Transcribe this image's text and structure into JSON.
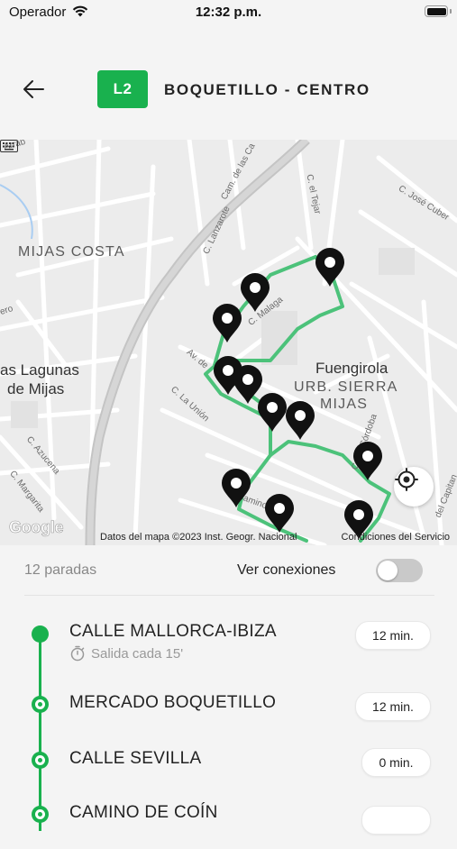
{
  "status_bar": {
    "carrier": "Operador",
    "time": "12:32 p.m."
  },
  "header": {
    "line_code": "L2",
    "route_name": "BOQUETILLO - CENTRO",
    "accent_color": "#19b14e"
  },
  "map": {
    "place_labels": [
      "MIJAS COSTA",
      "Fuengirola",
      "URB. SIERRA",
      "MIJAS",
      "as Lagunas",
      "de Mijas"
    ],
    "street_labels": [
      "Arrab",
      "Cam. de las Ca",
      "C. Lanzarote",
      "C. el Tejar",
      "C. José Cuber",
      "C. Malaga",
      "C. La Unión",
      "Av. de",
      "C. Azucena",
      "C. Margarita",
      "C. de Córdoba",
      "del Capitan",
      "Camino de",
      "ero"
    ],
    "attribution": "Datos del mapa ©2023 Inst. Geogr. Nacional",
    "terms": "Condiciones del Servicio",
    "provider": "Google"
  },
  "summary": {
    "stop_count": "12 paradas",
    "connections_label": "Ver conexiones",
    "connections_enabled": false
  },
  "stops": [
    {
      "name": "CALLE MALLORCA-IBIZA",
      "subtitle": "Salida cada 15'",
      "time": "12 min."
    },
    {
      "name": "MERCADO BOQUETILLO",
      "time": "12 min."
    },
    {
      "name": "CALLE SEVILLA",
      "time": "0 min."
    },
    {
      "name": "CAMINO DE COÍN"
    }
  ]
}
